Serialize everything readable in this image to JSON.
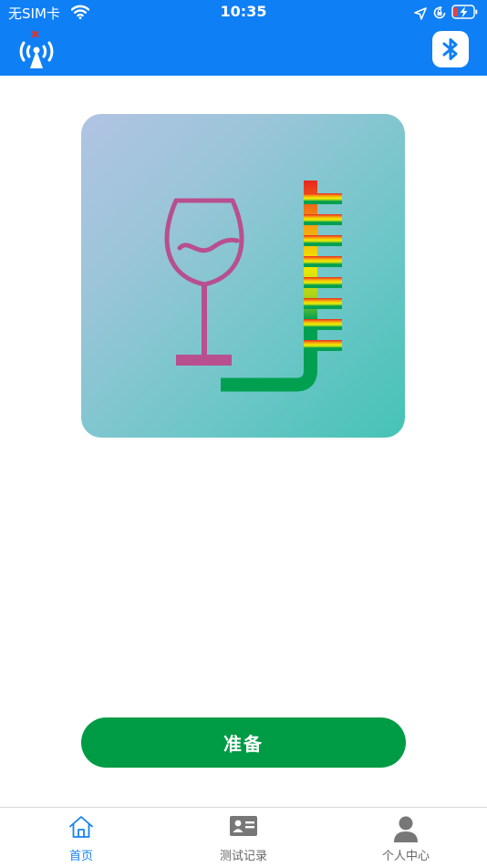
{
  "status_bar": {
    "carrier": "无SIM卡",
    "time": "10:35"
  },
  "header": {
    "left_icon": "signal-tower-icon",
    "right_icon": "bluetooth-icon"
  },
  "hero": {
    "icon": "wine-glass-meter-icon"
  },
  "main": {
    "ready_label": "准备"
  },
  "tabbar": {
    "tabs": [
      {
        "label": "首页",
        "icon": "home-icon",
        "active": true
      },
      {
        "label": "测试记录",
        "icon": "id-card-icon",
        "active": false
      },
      {
        "label": "个人中心",
        "icon": "person-icon",
        "active": false
      }
    ]
  },
  "colors": {
    "header_bg": "#0f7ff5",
    "button": "#009b45",
    "active_tab": "#1583f2",
    "glass": "#b84f8e"
  }
}
